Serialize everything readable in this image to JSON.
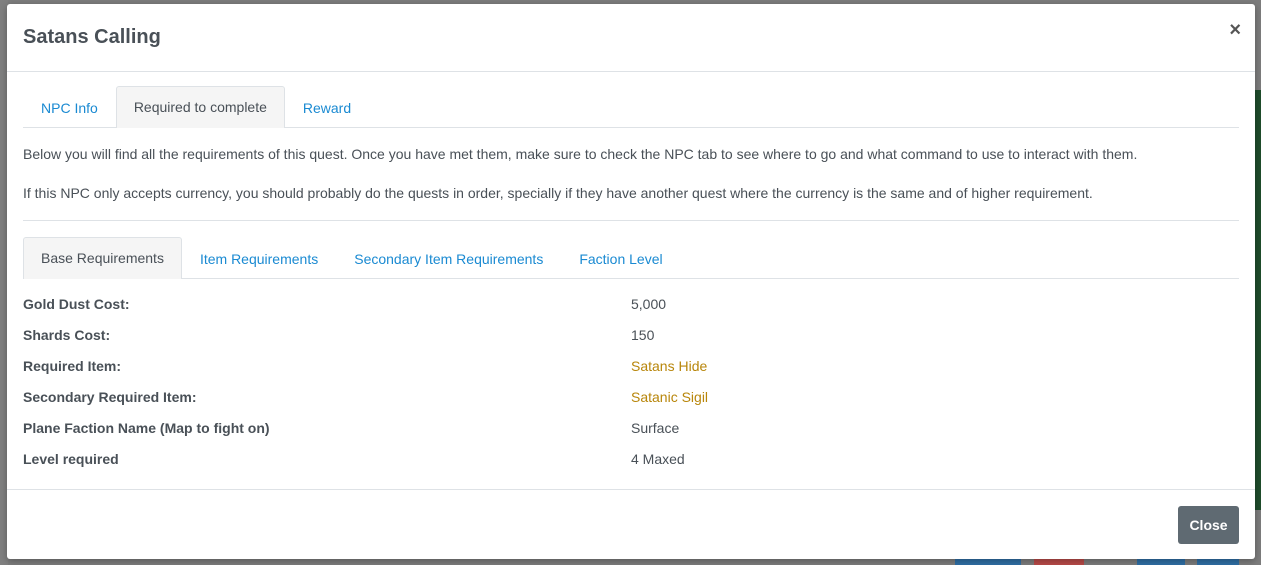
{
  "modal": {
    "title": "Satans Calling",
    "close_icon": "×",
    "tabs": [
      {
        "label": "NPC Info",
        "active": false
      },
      {
        "label": "Required to complete",
        "active": true
      },
      {
        "label": "Reward",
        "active": false
      }
    ],
    "paragraphs": [
      "Below you will find all the requirements of this quest. Once you have met them, make sure to check the NPC tab to see where to go and what command to use to interact with them.",
      "If this NPC only accepts currency, you should probably do the quests in order, specially if they have another quest where the currency is the same and of higher requirement."
    ],
    "subtabs": [
      {
        "label": "Base Requirements",
        "active": true
      },
      {
        "label": "Item Requirements",
        "active": false
      },
      {
        "label": "Secondary Item Requirements",
        "active": false
      },
      {
        "label": "Faction Level",
        "active": false
      }
    ],
    "requirements": [
      {
        "label": "Gold Dust Cost:",
        "value": "5,000"
      },
      {
        "label": "Shards Cost:",
        "value": "150"
      },
      {
        "label": "Required Item:",
        "value": "Satans Hide"
      },
      {
        "label": "Secondary Required Item:",
        "value": "Satanic Sigil"
      },
      {
        "label": "Plane Faction Name (Map to fight on)",
        "value": "Surface"
      },
      {
        "label": "Level required",
        "value": "4 Maxed"
      }
    ],
    "footer": {
      "close_label": "Close"
    }
  },
  "colors": {
    "link": "#1a8ad2",
    "item": "#b8860b",
    "button": "#5f6a72"
  }
}
